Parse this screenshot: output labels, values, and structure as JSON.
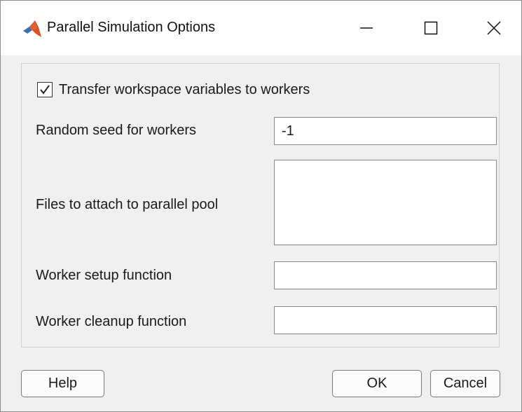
{
  "window": {
    "title": "Parallel Simulation Options",
    "app_icon": "matlab-icon",
    "controls": [
      "minimize-icon",
      "maximize-icon",
      "close-icon"
    ]
  },
  "options": {
    "transfer_checkbox": {
      "label": "Transfer workspace variables to workers",
      "checked": true
    },
    "random_seed": {
      "label": "Random seed for workers",
      "value": "-1"
    },
    "files_to_attach": {
      "label": "Files to attach to parallel pool",
      "value": ""
    },
    "worker_setup": {
      "label": "Worker setup function",
      "value": ""
    },
    "worker_cleanup": {
      "label": "Worker cleanup function",
      "value": ""
    }
  },
  "buttons": {
    "help": "Help",
    "ok": "OK",
    "cancel": "Cancel"
  },
  "colors": {
    "dialog_background": "#f0f0f0",
    "titlebar_background": "#ffffff",
    "field_border": "#8a8a8a",
    "button_border": "#7a7a7a"
  }
}
